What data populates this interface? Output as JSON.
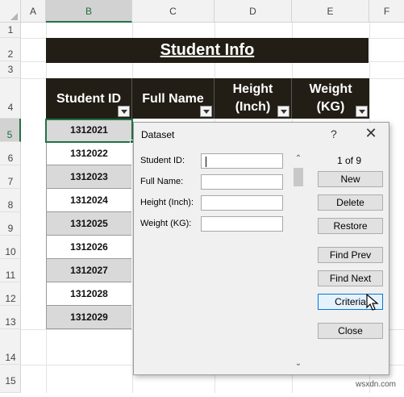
{
  "columns": [
    "A",
    "B",
    "C",
    "D",
    "E",
    "F"
  ],
  "rows": [
    "1",
    "2",
    "3",
    "4",
    "5",
    "6",
    "7",
    "8",
    "9",
    "10",
    "11",
    "12",
    "13",
    "14",
    "15"
  ],
  "sheet": {
    "title": "Student Info",
    "headers": {
      "student_id": "Student ID",
      "full_name": "Full Name",
      "height_line1": "Height",
      "height_line2": "(Inch)",
      "weight_line1": "Weight",
      "weight_line2": "(KG)"
    },
    "student_ids": [
      "1312021",
      "1312022",
      "1312023",
      "1312024",
      "1312025",
      "1312026",
      "1312027",
      "1312028",
      "1312029"
    ]
  },
  "dialog": {
    "title": "Dataset",
    "help": "?",
    "close": "✕",
    "record_counter": "1 of 9",
    "fields": [
      {
        "label": "Student ID:",
        "value": ""
      },
      {
        "label": "Full Name:",
        "value": ""
      },
      {
        "label": "Height (Inch):",
        "value": ""
      },
      {
        "label": "Weight (KG):",
        "value": ""
      }
    ],
    "buttons": {
      "new": "New",
      "delete": "Delete",
      "restore": "Restore",
      "find_prev": "Find Prev",
      "find_next": "Find Next",
      "criteria": "Criteria",
      "close": "Close"
    }
  },
  "watermark": "wsxdn.com",
  "colors": {
    "header_dark": "#221e15",
    "excel_green": "#217346",
    "banded_grey": "#d9d9d9"
  }
}
